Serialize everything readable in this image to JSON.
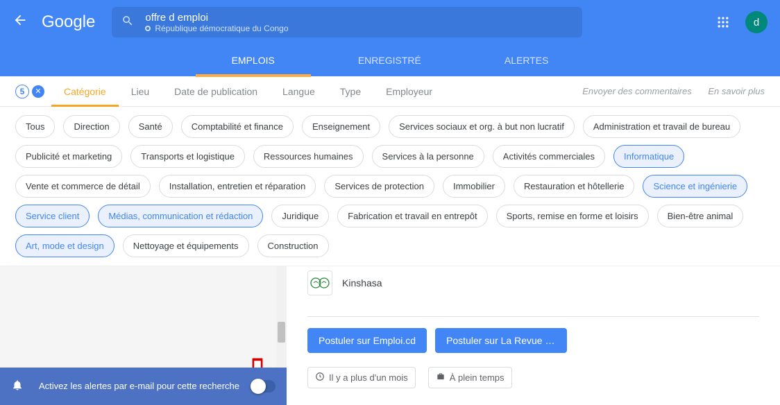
{
  "header": {
    "logo": "Google",
    "search_query": "offre d emploi",
    "search_location": "République démocratique du Congo",
    "avatar_letter": "d"
  },
  "tabs": {
    "emplois": "EMPLOIS",
    "enregistre": "ENREGISTRÉ",
    "alertes": "ALERTES"
  },
  "filters": {
    "count": "5",
    "categorie": "Catégorie",
    "lieu": "Lieu",
    "date": "Date de publication",
    "langue": "Langue",
    "type": "Type",
    "employeur": "Employeur",
    "feedback": "Envoyer des commentaires",
    "learn_more": "En savoir plus"
  },
  "chips": {
    "r1": [
      "Tous",
      "Direction",
      "Santé",
      "Comptabilité et finance",
      "Enseignement",
      "Services sociaux et org. à but non lucratif",
      "Administration et travail de bureau",
      "Publicité et marketing"
    ],
    "r2": [
      "Transports et logistique",
      "Ressources humaines",
      "Services à la personne",
      "Activités commerciales",
      "Informatique",
      "Vente et commerce de détail"
    ],
    "r3": [
      "Installation, entretien et réparation",
      "Services de protection",
      "Immobilier",
      "Restauration et hôtellerie",
      "Science et ingénierie",
      "Service client",
      "Médias, communication et rédaction"
    ],
    "r4": [
      "Juridique",
      "Fabrication et travail en entrepôt",
      "Sports, remise en forme et loisirs",
      "Bien-être animal",
      "Art, mode et design",
      "Nettoyage et équipements",
      "Construction"
    ],
    "selected": [
      "Informatique",
      "Science et ingénierie",
      "Service client",
      "Médias, communication et rédaction",
      "Art, mode et design"
    ]
  },
  "job": {
    "location": "Kinshasa",
    "apply1": "Postuler sur Emploi.cd",
    "apply2": "Postuler sur La Revue De L'…",
    "meta_time": "Il y a plus d'un mois",
    "meta_type": "À plein temps"
  },
  "alert": {
    "text": "Activez les alertes par e-mail pour cette recherche"
  }
}
